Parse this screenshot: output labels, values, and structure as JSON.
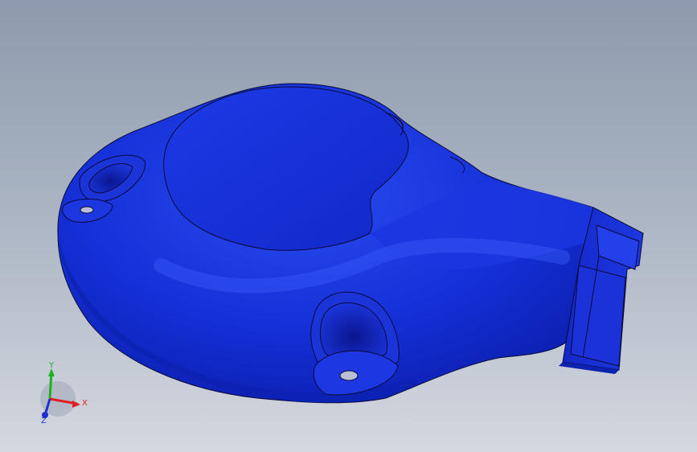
{
  "viewport": {
    "background_top": "#8e9aad",
    "background_bottom": "#d4d8df"
  },
  "model": {
    "part_color": "#1530d8",
    "edge_color": "#0a0a3a"
  },
  "triad": {
    "x_label": "X",
    "y_label": "Y",
    "z_label": "Z",
    "x_color": "#e02020",
    "y_color": "#20b020",
    "z_color": "#2030d0"
  }
}
